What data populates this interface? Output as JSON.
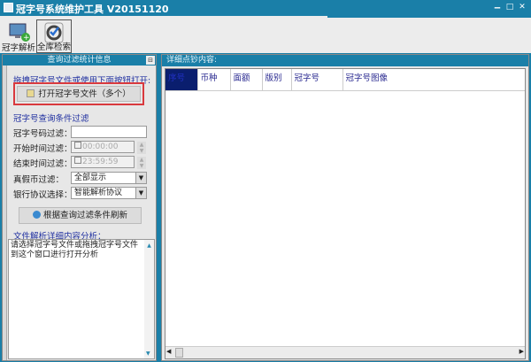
{
  "window": {
    "title": "冠字号系统维护工具 V20151120",
    "min": "‒",
    "max": "□",
    "close": "✕"
  },
  "toolbar": {
    "items": [
      {
        "label": "冠字解析",
        "icon": "monitor-add-icon"
      },
      {
        "label": "全库检索",
        "icon": "check-circle-icon"
      }
    ]
  },
  "left_panel": {
    "title": "查询过滤统计信息",
    "pin": "⊟",
    "drag_hint": "拖拽冠字号文件或使用下面按钮打开:",
    "open_button": "打开冠字号文件（多个）",
    "filter_section": "冠字号查询条件过滤",
    "filters": {
      "serial_label": "冠字号码过滤：",
      "serial_value": "",
      "start_label": "开始时间过滤：",
      "start_value": "00:00:00",
      "end_label": "结束时间过滤：",
      "end_value": "23:59:59",
      "fake_label": "真假币过滤：",
      "fake_value": "全部显示",
      "bank_label": "银行协议选择：",
      "bank_value": "智能解析协议"
    },
    "refresh_button": "根据查询过滤条件刷新",
    "analysis_title": "文件解析详细内容分析：",
    "analysis_text": "请选择冠字号文件或拖拽冠字号文件到这个窗口进行打开分析"
  },
  "right_panel": {
    "title": "详细点钞内容:",
    "columns": [
      "序号",
      "币种",
      "面额",
      "版别",
      "冠字号",
      "冠字号图像"
    ]
  },
  "colors": {
    "accent": "#1a7fa8",
    "selected_header": "#0a1e6e",
    "highlight_border": "#d9393e"
  }
}
